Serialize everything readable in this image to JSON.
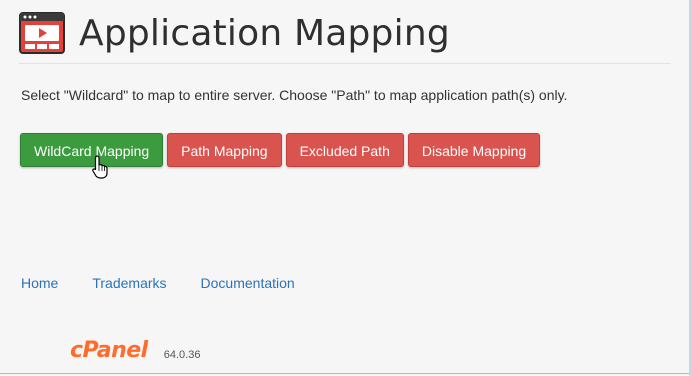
{
  "header": {
    "title": "Application Mapping",
    "icon": "video-window-icon",
    "icon_color": "#e5413b"
  },
  "description": "Select \"Wildcard\" to map to entire server. Choose \"Path\" to map application path(s) only.",
  "buttons": {
    "wildcard": "WildCard Mapping",
    "path": "Path Mapping",
    "excluded": "Excluded Path",
    "disable": "Disable Mapping"
  },
  "footer": {
    "links": [
      "Home",
      "Trademarks",
      "Documentation"
    ],
    "brand": "cPanel",
    "version": "64.0.36"
  },
  "colors": {
    "green": "#3c9b3f",
    "red": "#d9534f",
    "link": "#2d72b8",
    "brand": "#ff6c2c"
  }
}
